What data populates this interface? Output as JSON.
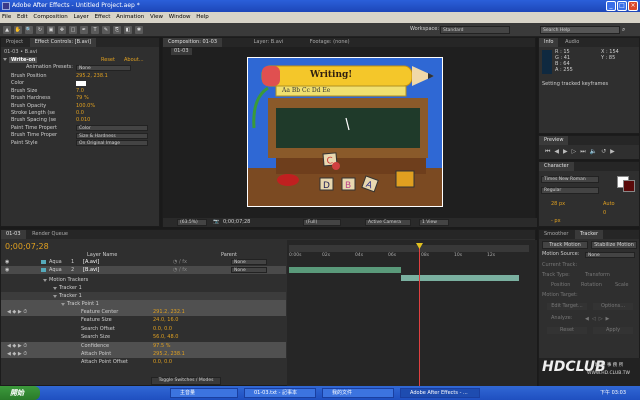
{
  "window": {
    "title": "Adobe After Effects - Untitled Project.aep *",
    "min": "_",
    "max": "□",
    "close": "×"
  },
  "menu": [
    "File",
    "Edit",
    "Composition",
    "Layer",
    "Effect",
    "Animation",
    "View",
    "Window",
    "Help"
  ],
  "toolbar": {
    "workspace_label": "Workspace:",
    "workspace_value": "Standard",
    "search_placeholder": "Search Help"
  },
  "left_panel": {
    "tabs": [
      "Project",
      "Effect Controls: [B.avi]"
    ],
    "breadcrumb": "01-03 • B.avi",
    "effect": {
      "name": "Write-on",
      "reset": "Reset",
      "about": "About...",
      "anim_presets_label": "Animation Presets:",
      "anim_presets_value": "None",
      "props": [
        {
          "label": "Brush Position",
          "value": "295.2, 238.1"
        },
        {
          "label": "Color",
          "value": ""
        },
        {
          "label": "Brush Size",
          "value": "7.0"
        },
        {
          "label": "Brush Hardness",
          "value": "79 %"
        },
        {
          "label": "Brush Opacity",
          "value": "100.0%"
        },
        {
          "label": "Stroke Length (se",
          "value": "0.0"
        },
        {
          "label": "Brush Spacing (se",
          "value": "0.010"
        },
        {
          "label": "Paint Time Propert",
          "value": "Color"
        },
        {
          "label": "Brush Time Proper",
          "value": "Size & Hardness"
        },
        {
          "label": "Paint Style",
          "value": "On Original Image"
        }
      ]
    }
  },
  "comp_panel": {
    "tabs": [
      "Composition: 01-03",
      "Layer: B.avi",
      "Footage: (none)"
    ],
    "comp_tab": "01-03",
    "chalk_title": "Writing!",
    "ruler_text": "Aa Bb Cc Dd Ee",
    "blocks": [
      "C",
      "D",
      "B",
      "A"
    ],
    "bottom": {
      "zoom": "(63.5%)",
      "time": "0;00;07;28",
      "res": "(Full)",
      "camera": "Active Camera",
      "view": "1 View"
    }
  },
  "info_panel": {
    "tabs": [
      "Info",
      "Audio"
    ],
    "r": "R : 15",
    "g": "G : 41",
    "b": "B : 64",
    "a": "A : 255",
    "x": "X : 154",
    "y": "Y : 85",
    "status": "Setting tracked keyframes"
  },
  "preview_panel": {
    "tab": "Preview"
  },
  "character_panel": {
    "tab": "Character",
    "font": "Times New Roman",
    "style": "Regular",
    "size": "28 px",
    "leading": "Auto",
    "tracking": "0",
    "stroke": "- px"
  },
  "timeline": {
    "tabs": [
      "01-03",
      "Render Queue"
    ],
    "timecode": "0;00;07;28",
    "col_layer": "Layer Name",
    "col_parent": "Parent",
    "ruler": [
      "0:00s",
      "02s",
      "04s",
      "06s",
      "08s",
      "10s",
      "12s"
    ],
    "layers": [
      {
        "color": "Aqua",
        "num": "1",
        "name": "[A.avi]",
        "parent": "None"
      },
      {
        "color": "Aqua",
        "num": "2",
        "name": "[B.avi]",
        "parent": "None"
      }
    ],
    "tree": [
      "Motion Trackers",
      "Tracker 1",
      "Tracker 1",
      "Track Point 1"
    ],
    "props": [
      {
        "label": "Feature Center",
        "value": "291.2, 232.1"
      },
      {
        "label": "Feature Size",
        "value": "24.0, 16.0"
      },
      {
        "label": "Search Offset",
        "value": "0.0, 0.0"
      },
      {
        "label": "Search Size",
        "value": "56.0, 48.0"
      },
      {
        "label": "Confidence",
        "value": "97.5 %"
      },
      {
        "label": "Attach Point",
        "value": "295.2, 238.1"
      },
      {
        "label": "Attach Point Offset",
        "value": "0.0, 0.0"
      }
    ],
    "toggle": "Toggle Switches / Modes"
  },
  "tracker_panel": {
    "tabs": [
      "Smoother",
      "Tracker"
    ],
    "track_motion": "Track Motion",
    "stabilize": "Stabilize Motion",
    "motion_source_label": "Motion Source:",
    "motion_source": "None",
    "current_track": "Current Track:",
    "track_type": "Track Type:",
    "track_type_val": "Transform",
    "position": "Position",
    "rotation": "Rotation",
    "scale": "Scale",
    "motion_target": "Motion Target:",
    "edit_target": "Edit Target...",
    "options": "Options...",
    "analyze": "Analyze:",
    "reset": "Reset",
    "apply": "Apply"
  },
  "taskbar": {
    "start": "開始",
    "tasks": [
      "主音量",
      "01-03.txt - 記事本",
      "我的文件",
      "Adobe After Effects - ..."
    ],
    "clock": "下午 03:03"
  },
  "watermark": {
    "brand": "HDCLUB",
    "sub": "精 研 事 務 所",
    "url": "WWW.HD.CLUB.TW"
  }
}
